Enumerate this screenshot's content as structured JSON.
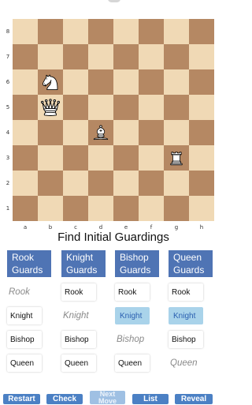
{
  "board": {
    "ranks": [
      "8",
      "7",
      "6",
      "5",
      "4",
      "3",
      "2",
      "1"
    ],
    "files": [
      "a",
      "b",
      "c",
      "d",
      "e",
      "f",
      "g",
      "h"
    ],
    "pieces": [
      {
        "square": "b6",
        "piece": "knight",
        "color": "white",
        "icon": "white-knight-icon"
      },
      {
        "square": "b5",
        "piece": "queen",
        "color": "white",
        "icon": "white-queen-icon"
      },
      {
        "square": "d4",
        "piece": "bishop",
        "color": "white",
        "icon": "white-bishop-icon"
      },
      {
        "square": "g3",
        "piece": "rook",
        "color": "white",
        "icon": "white-rook-icon"
      }
    ],
    "colors": {
      "light": "#f0d9b5",
      "dark": "#b58863"
    }
  },
  "title": "Find Initial Guardings",
  "columns": [
    {
      "head_line1": "Rook",
      "head_line2": "Guards",
      "cells": [
        {
          "label": "Rook",
          "style": "italic"
        },
        {
          "label": "Knight",
          "style": "box"
        },
        {
          "label": "Bishop",
          "style": "box"
        },
        {
          "label": "Queen",
          "style": "box"
        }
      ]
    },
    {
      "head_line1": "Knight",
      "head_line2": "Guards",
      "cells": [
        {
          "label": "Rook",
          "style": "box"
        },
        {
          "label": "Knight",
          "style": "italic"
        },
        {
          "label": "Bishop",
          "style": "box"
        },
        {
          "label": "Queen",
          "style": "box"
        }
      ]
    },
    {
      "head_line1": "Bishop",
      "head_line2": "Guards",
      "cells": [
        {
          "label": "Rook",
          "style": "box"
        },
        {
          "label": "Knight",
          "style": "selected"
        },
        {
          "label": "Bishop",
          "style": "italic"
        },
        {
          "label": "Queen",
          "style": "box"
        }
      ]
    },
    {
      "head_line1": "Queen",
      "head_line2": "Guards",
      "cells": [
        {
          "label": "Rook",
          "style": "box"
        },
        {
          "label": "Knight",
          "style": "selected"
        },
        {
          "label": "Bishop",
          "style": "box"
        },
        {
          "label": "Queen",
          "style": "italic"
        }
      ]
    }
  ],
  "buttons": {
    "restart": "Restart",
    "check": "Check",
    "next_line1": "Next",
    "next_line2": "Move",
    "list": "List",
    "reveal": "Reveal"
  },
  "accent_color": "#4f74b4",
  "selected_color": "#a9d3ea"
}
